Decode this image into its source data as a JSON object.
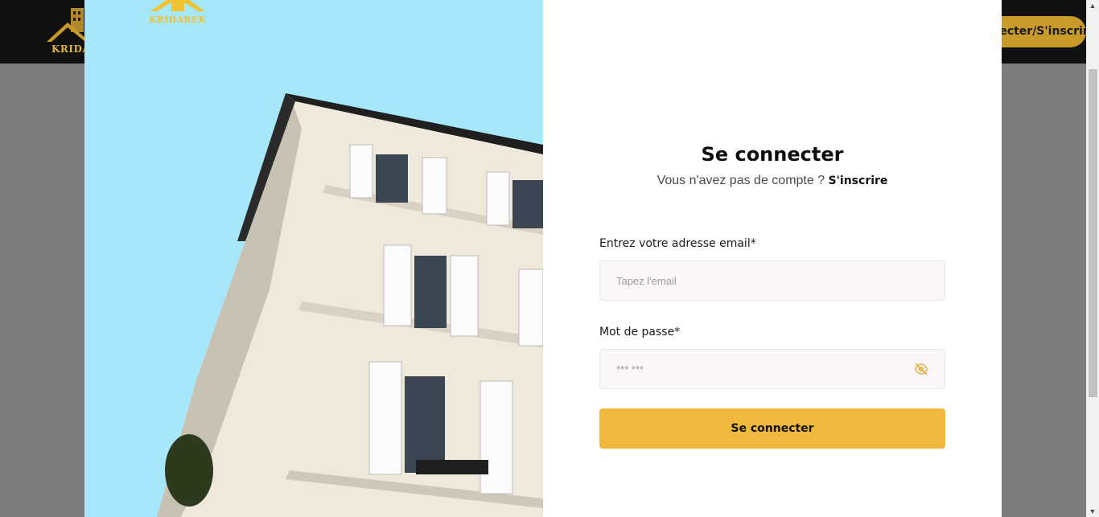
{
  "background": {
    "logo_text": "KRIDAREK",
    "login_button_label": "Se connecter/S'inscrire"
  },
  "modal": {
    "logo_text": "KRIDAREK",
    "title": "Se connecter",
    "subtitle_text": "Vous n'avez pas de compte ? ",
    "subtitle_link": "S'inscrire",
    "email": {
      "label": "Entrez votre adresse email*",
      "placeholder": "Tapez l'email",
      "value": ""
    },
    "password": {
      "label": "Mot de passe*",
      "placeholder": "*** ***",
      "value": "",
      "visibility_icon": "eye-off-icon"
    },
    "submit_label": "Se connecter"
  },
  "colors": {
    "accent": "#f0b93d",
    "image_sky": "#a6e7fb",
    "overlay": "#7d7d7d"
  }
}
